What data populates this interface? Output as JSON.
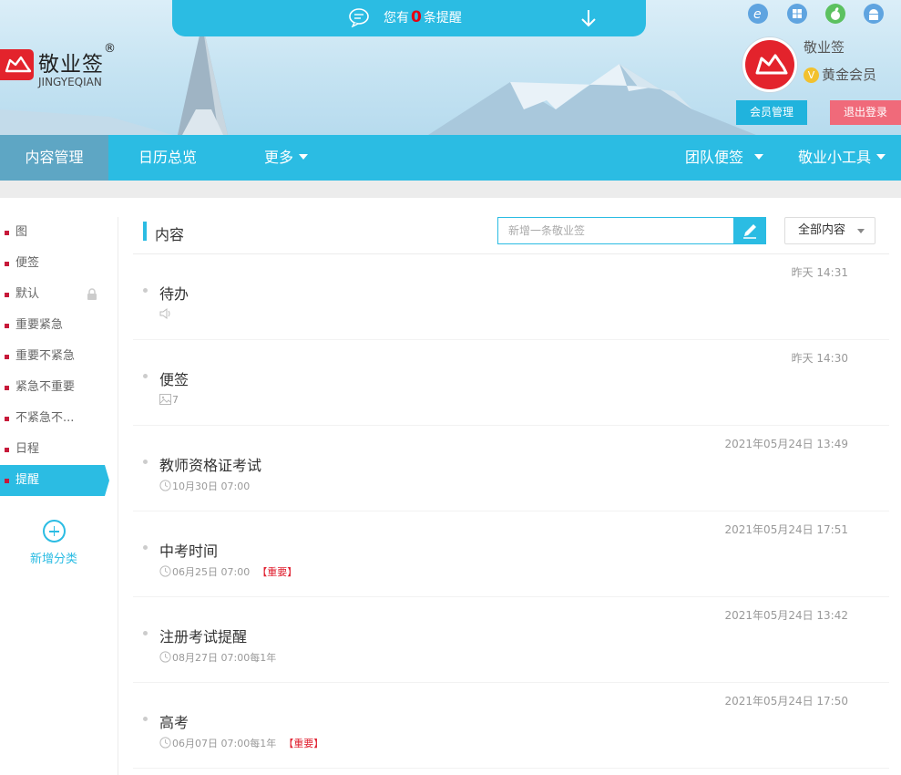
{
  "notice": {
    "prefix": "您有",
    "count": "0",
    "suffix": "条提醒"
  },
  "brand": {
    "name": "敬业签",
    "reg": "®",
    "pinyin": "JINGYEQIAN"
  },
  "platforms": [
    "ie-icon",
    "windows-icon",
    "apple-icon",
    "android-icon"
  ],
  "user": {
    "name": "敬业签",
    "vip_badge": "V",
    "vip_level": "黄金会员",
    "member_btn": "会员管理",
    "logout_btn": "退出登录"
  },
  "nav": {
    "left": [
      "内容管理",
      "日历总览",
      "更多"
    ],
    "right": [
      "团队便签",
      "敬业小工具"
    ]
  },
  "sidebar": {
    "categories": [
      "图",
      "便签",
      "默认",
      "重要紧急",
      "重要不紧急",
      "紧急不重要",
      "不紧急不...",
      "日程",
      "提醒"
    ],
    "active": "提醒",
    "add_label": "新增分类"
  },
  "content": {
    "title": "内容",
    "new_placeholder": "新增一条敬业签",
    "filter": "全部内容",
    "notes": [
      {
        "time": "昨天 14:31",
        "title": "待办",
        "meta_type": "audio",
        "meta": "",
        "tag": ""
      },
      {
        "time": "昨天 14:30",
        "title": "便签",
        "meta_type": "image",
        "meta": "7",
        "tag": ""
      },
      {
        "time": "2021年05月24日 13:49",
        "title": "教师资格证考试",
        "meta_type": "clock",
        "meta": "10月30日 07:00",
        "tag": ""
      },
      {
        "time": "2021年05月24日 17:51",
        "title": "中考时间",
        "meta_type": "clock",
        "meta": "06月25日 07:00",
        "tag": "【重要】"
      },
      {
        "time": "2021年05月24日 13:42",
        "title": "注册考试提醒",
        "meta_type": "clock",
        "meta": "08月27日 07:00每1年",
        "tag": ""
      },
      {
        "time": "2021年05月24日 17:50",
        "title": "高考",
        "meta_type": "clock",
        "meta": "06月07日 07:00每1年",
        "tag": "【重要】"
      }
    ]
  },
  "colors": {
    "primary": "#2bbce3",
    "brand_red": "#e3232c",
    "logout": "#f06a7a",
    "important": "#e02030"
  }
}
